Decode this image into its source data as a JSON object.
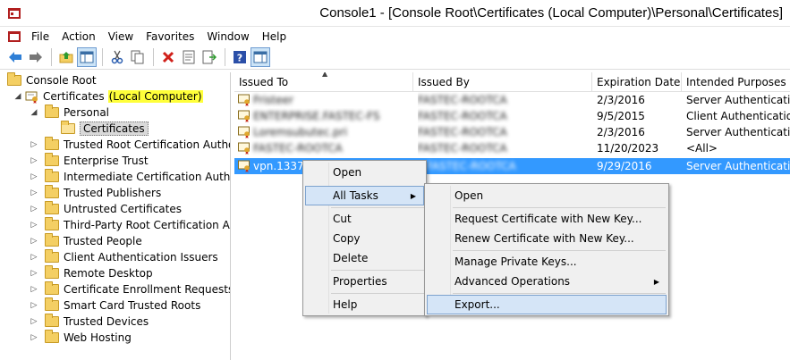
{
  "window": {
    "title": "Console1 - [Console Root\\Certificates (Local Computer)\\Personal\\Certificates]"
  },
  "menubar": {
    "items": [
      "File",
      "Action",
      "View",
      "Favorites",
      "Window",
      "Help"
    ]
  },
  "toolbar": {
    "buttons": [
      "back-icon",
      "forward-icon",
      "up-folder-icon",
      "show-hide-tree-icon",
      "cut-icon",
      "copy-icon",
      "delete-icon",
      "properties-icon",
      "export-list-icon",
      "help-icon",
      "show-action-pane-icon"
    ]
  },
  "tree": {
    "root": "Console Root",
    "certificates_prefix": "Certificates",
    "certificates_highlight": "(Local Computer)",
    "personal": "Personal",
    "personal_certs": "Certificates",
    "stores": [
      "Trusted Root Certification Authorities",
      "Enterprise Trust",
      "Intermediate Certification Authorities",
      "Trusted Publishers",
      "Untrusted Certificates",
      "Third-Party Root Certification Authorities",
      "Trusted People",
      "Client Authentication Issuers",
      "Remote Desktop",
      "Certificate Enrollment Requests",
      "Smart Card Trusted Roots",
      "Trusted Devices",
      "Web Hosting"
    ]
  },
  "list": {
    "columns": [
      "Issued To",
      "Issued By",
      "Expiration Date",
      "Intended Purposes"
    ],
    "rows": [
      {
        "issued_to": "Fristeer",
        "issued_by": "FASTEC-ROOTCA",
        "expiration": "2/3/2016",
        "purposes": "Server Authentication"
      },
      {
        "issued_to": "ENTERPRISE.FASTEC-FS",
        "issued_by": "FASTEC-ROOTCA",
        "expiration": "9/5/2015",
        "purposes": "Client Authentication"
      },
      {
        "issued_to": "Loremsubutec.pri",
        "issued_by": "FASTEC-ROOTCA",
        "expiration": "2/3/2016",
        "purposes": "Server Authentication"
      },
      {
        "issued_to": "FASTEC-ROOTCA",
        "issued_by": "FASTEC-ROOTCA",
        "expiration": "11/20/2023",
        "purposes": "<All>"
      },
      {
        "issued_to": "vpn.1337c",
        "issued_by": "FASTEC-ROOTCA",
        "expiration": "9/29/2016",
        "purposes": "Server Authentication"
      }
    ]
  },
  "context_menu": {
    "open": "Open",
    "all_tasks": "All Tasks",
    "cut": "Cut",
    "copy": "Copy",
    "delete": "Delete",
    "properties": "Properties",
    "help": "Help"
  },
  "submenu": {
    "open": "Open",
    "request_new_key": "Request Certificate with New Key...",
    "renew_new_key": "Renew Certificate with New Key...",
    "manage_private_keys": "Manage Private Keys...",
    "advanced_operations": "Advanced Operations",
    "export": "Export..."
  },
  "colors": {
    "selection": "#3399ff",
    "highlight": "#ffff3a",
    "menu_hover": "#d5e5f7"
  }
}
